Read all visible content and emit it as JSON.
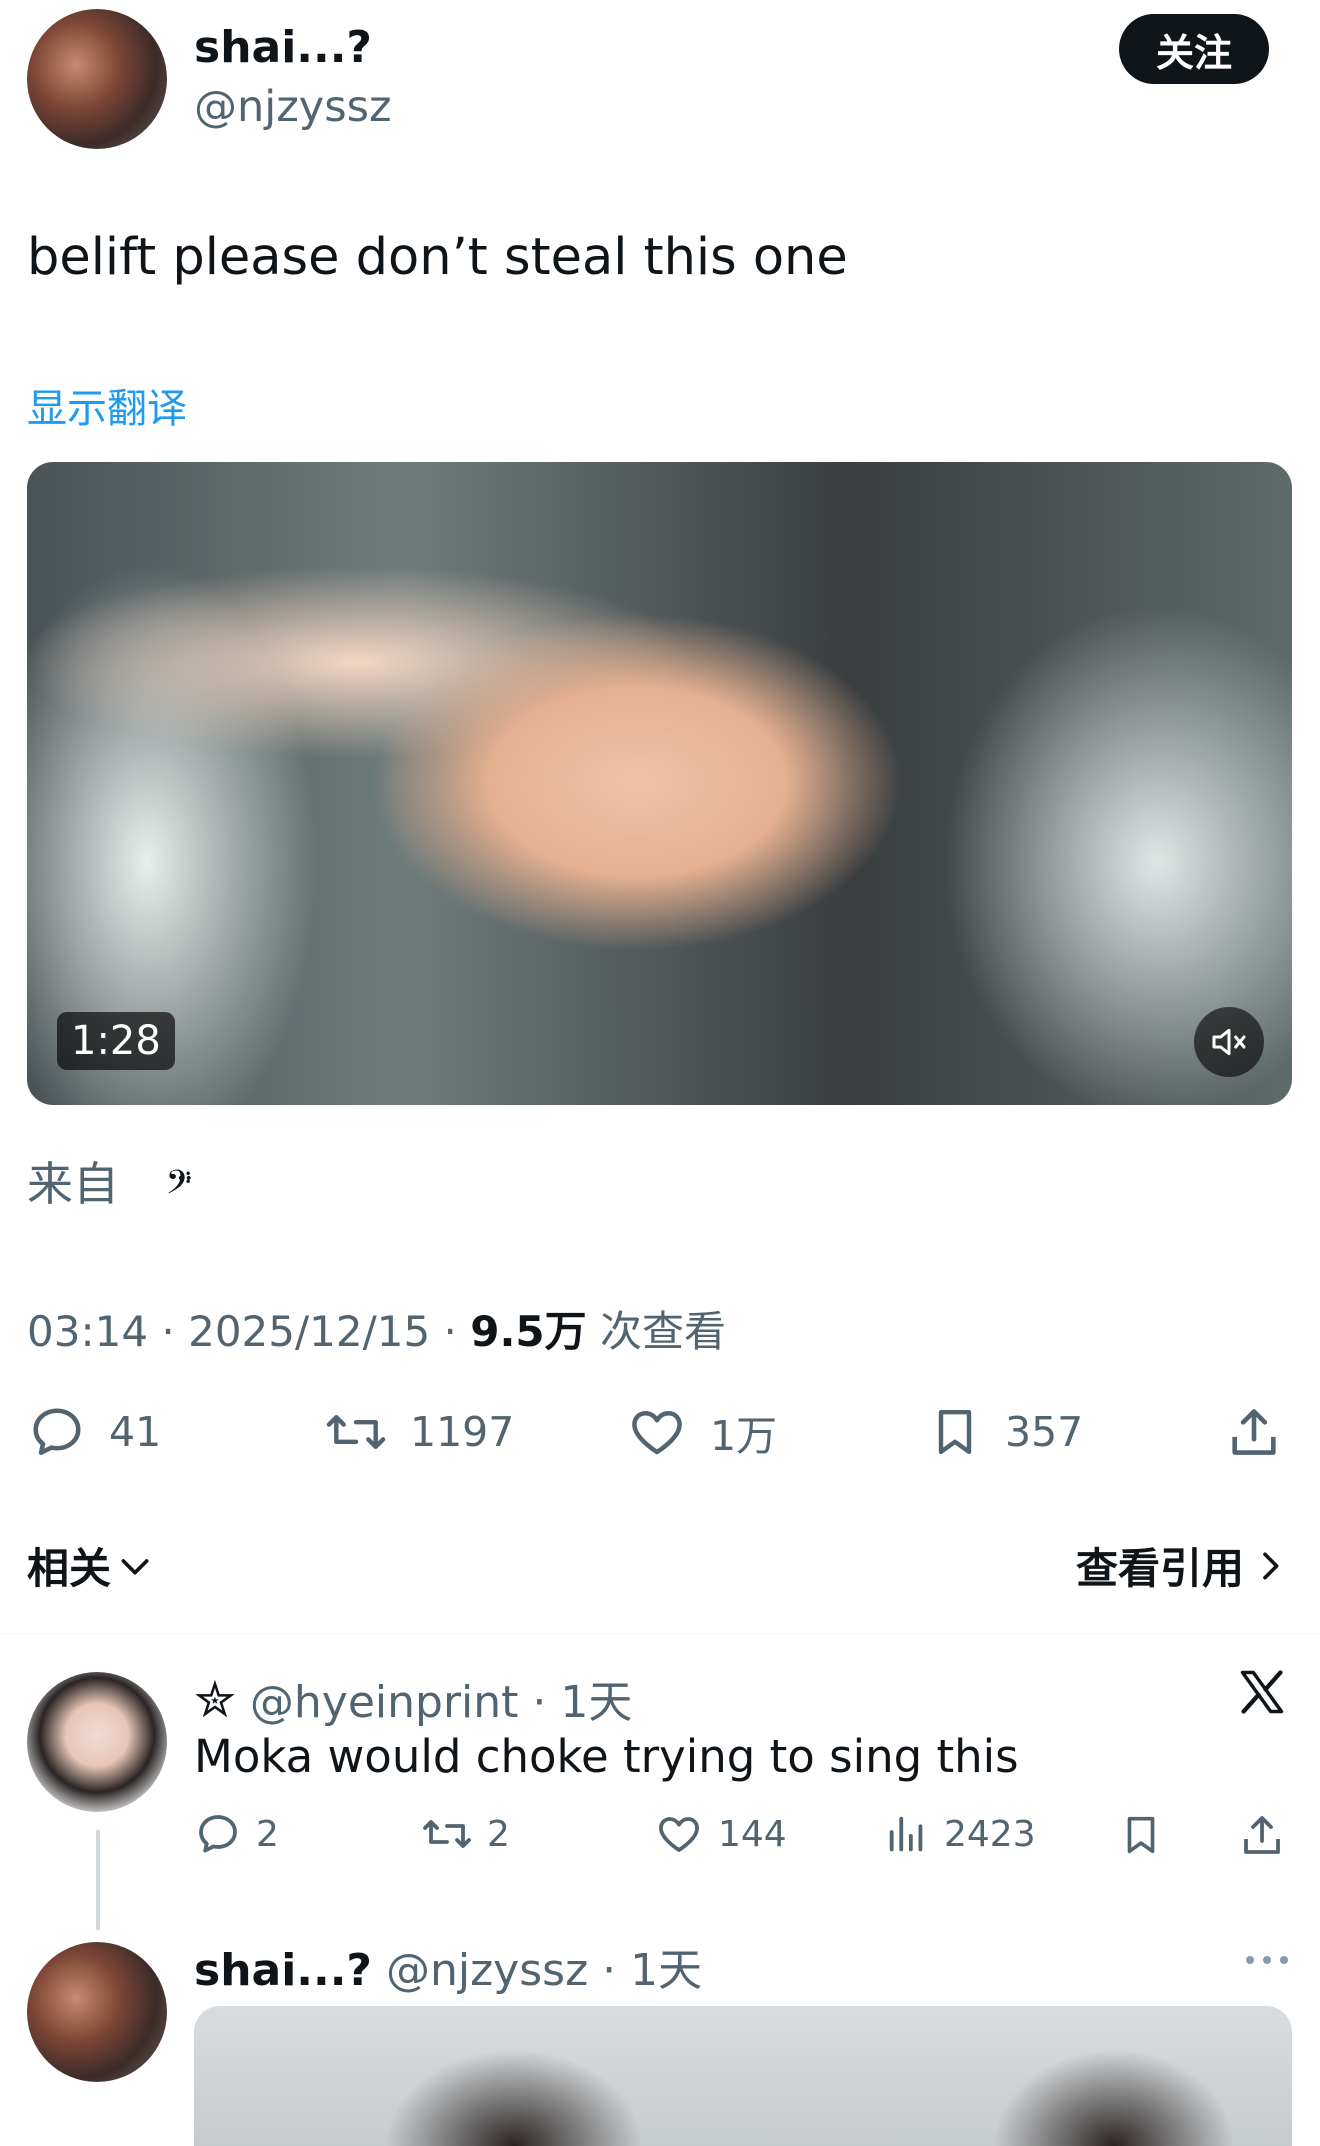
{
  "tweet": {
    "author_name": "shai...?",
    "author_handle": "@njzyssz",
    "follow_label": "关注",
    "text": "belift please don’t steal this one",
    "translate_label": "显示翻译",
    "video_duration": "1:28",
    "source_prefix": "来自",
    "source_glyph": "𝄢̈",
    "time": "03:14",
    "date": "2025/12/15",
    "views": "9.5万",
    "views_suffix": "次查看",
    "replies": "41",
    "retweets": "1197",
    "likes": "1万",
    "bookmarks": "357",
    "related_label": "相关",
    "view_quotes_label": "查看引用"
  },
  "reply": {
    "author_prefix_glyph": "✮",
    "author_handle": "@hyeinprint",
    "age": "1天",
    "text": "Moka would choke trying to sing this",
    "replies": "2",
    "retweets": "2",
    "likes": "144",
    "views": "2423"
  },
  "reply2": {
    "author_name": "shai...?",
    "author_handle": "@njzyssz",
    "age": "1天"
  },
  "colors": {
    "accent": "#1d9bf0",
    "text": "#0f1419",
    "muted": "#536471"
  }
}
